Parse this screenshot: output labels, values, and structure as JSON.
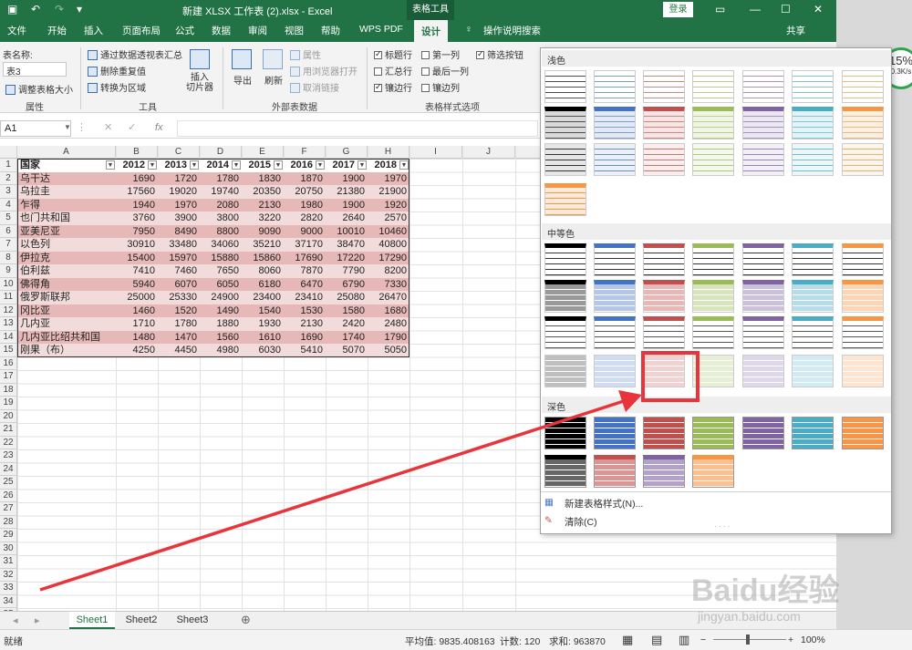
{
  "window": {
    "title": "新建 XLSX 工作表 (2).xlsx  -  Excel",
    "context_tab": "表格工具",
    "login": "登录",
    "share": "共享",
    "tell_me": "操作说明搜索"
  },
  "tabs": [
    "文件",
    "开始",
    "插入",
    "页面布局",
    "公式",
    "数据",
    "审阅",
    "视图",
    "帮助",
    "WPS PDF",
    "设计"
  ],
  "ribbon": {
    "props": {
      "table_name_label": "表名称:",
      "table_name": "表3",
      "resize": "调整表格大小",
      "group": "属性"
    },
    "tools": {
      "pivot": "通过数据透视表汇总",
      "dedupe": "删除重复值",
      "convert": "转换为区域",
      "slicer": "插入\n切片器",
      "group": "工具"
    },
    "external": {
      "export": "导出",
      "refresh": "刷新",
      "properties": "属性",
      "browser": "用浏览器打开",
      "unlink": "取消链接",
      "group": "外部表数据"
    },
    "style_options": {
      "header_row": "标题行",
      "total_row": "汇总行",
      "banded_rows": "镶边行",
      "first_col": "第一列",
      "last_col": "最后一列",
      "banded_cols": "镶边列",
      "filter_btn": "筛选按钮",
      "group": "表格样式选项"
    }
  },
  "formula_bar": {
    "name_box": "A1",
    "fx": "fx"
  },
  "columns": [
    "A",
    "B",
    "C",
    "D",
    "E",
    "F",
    "G",
    "H",
    "I",
    "J"
  ],
  "rows": [
    "1",
    "2",
    "3",
    "4",
    "5",
    "6",
    "7",
    "8",
    "9",
    "10",
    "11",
    "12",
    "13",
    "14",
    "15",
    "16",
    "17",
    "18",
    "19",
    "20",
    "21",
    "22",
    "23",
    "24",
    "25",
    "26",
    "27",
    "28",
    "29",
    "30",
    "31",
    "32",
    "33",
    "34",
    "35"
  ],
  "table": {
    "headers": [
      "国家",
      "2012",
      "2013",
      "2014",
      "2015",
      "2016",
      "2017",
      "2018"
    ],
    "rows": [
      [
        "乌干达",
        "1690",
        "1720",
        "1780",
        "1830",
        "1870",
        "1900",
        "1970"
      ],
      [
        "乌拉圭",
        "17560",
        "19020",
        "19740",
        "20350",
        "20750",
        "21380",
        "21900"
      ],
      [
        "乍得",
        "1940",
        "1970",
        "2080",
        "2130",
        "1980",
        "1900",
        "1920"
      ],
      [
        "也门共和国",
        "3760",
        "3900",
        "3800",
        "3220",
        "2820",
        "2640",
        "2570"
      ],
      [
        "亚美尼亚",
        "7950",
        "8490",
        "8800",
        "9090",
        "9000",
        "10010",
        "10460"
      ],
      [
        "以色列",
        "30910",
        "33480",
        "34060",
        "35210",
        "37170",
        "38470",
        "40800"
      ],
      [
        "伊拉克",
        "15400",
        "15970",
        "15880",
        "15860",
        "17690",
        "17220",
        "17290"
      ],
      [
        "伯利兹",
        "7410",
        "7460",
        "7650",
        "8060",
        "7870",
        "7790",
        "8200"
      ],
      [
        "佛得角",
        "5940",
        "6070",
        "6050",
        "6180",
        "6470",
        "6790",
        "7330"
      ],
      [
        "俄罗斯联邦",
        "25000",
        "25330",
        "24900",
        "23400",
        "23410",
        "25080",
        "26470"
      ],
      [
        "冈比亚",
        "1460",
        "1520",
        "1490",
        "1540",
        "1530",
        "1580",
        "1680"
      ],
      [
        "几内亚",
        "1710",
        "1780",
        "1880",
        "1930",
        "2130",
        "2420",
        "2480"
      ],
      [
        "几内亚比绍共和国",
        "1480",
        "1470",
        "1560",
        "1610",
        "1690",
        "1740",
        "1790"
      ],
      [
        "刚果（布）",
        "4250",
        "4450",
        "4980",
        "6030",
        "5410",
        "5070",
        "5050"
      ]
    ]
  },
  "sheets": [
    "Sheet1",
    "Sheet2",
    "Sheet3"
  ],
  "status": {
    "ready": "就绪",
    "average": "平均值: 9835.408163",
    "count": "计数: 120",
    "sum": "求和: 963870",
    "zoom": "100%"
  },
  "gallery": {
    "light": "浅色",
    "medium": "中等色",
    "dark": "深色",
    "new_style": "新建表格样式(N)...",
    "clear": "清除(C)",
    "colors": [
      "#000000",
      "#4472c4",
      "#c0504d",
      "#9bbb59",
      "#8064a2",
      "#4bacc6",
      "#f79646"
    ]
  },
  "widgets": {
    "speed": "15%",
    "speed_sub": "0.3K/s",
    "watermark": "Baidu经验",
    "watermark_url": "jingyan.baidu.com"
  }
}
